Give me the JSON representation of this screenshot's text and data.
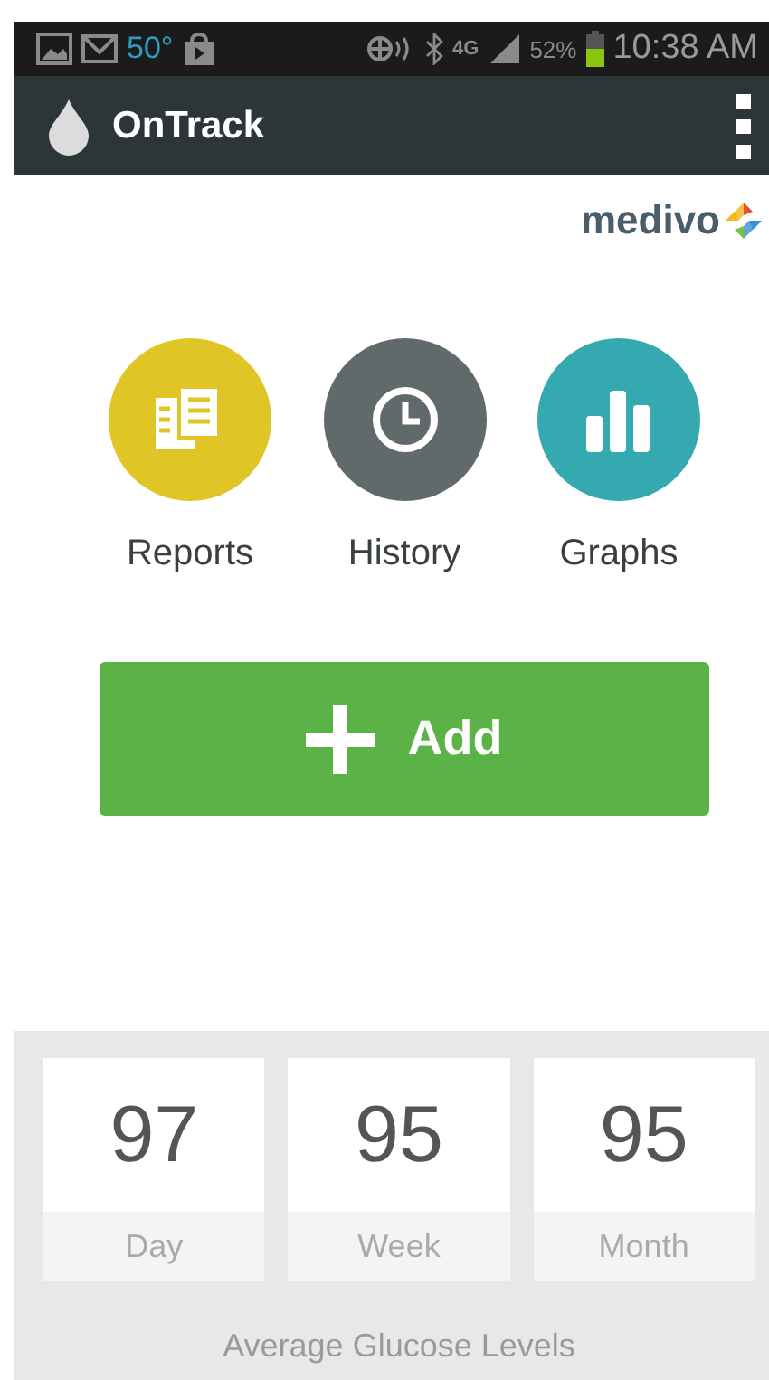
{
  "status_bar": {
    "temperature": "50°",
    "network": "4G",
    "battery": "52%",
    "time": "10:38 AM"
  },
  "app_bar": {
    "title": "OnTrack"
  },
  "brand": {
    "name": "medivo"
  },
  "shortcuts": [
    {
      "kind": "reports",
      "label": "Reports",
      "color": "#e0c527"
    },
    {
      "kind": "history",
      "label": "History",
      "color": "#616a6a"
    },
    {
      "kind": "graphs",
      "label": "Graphs",
      "color": "#34a9b0"
    }
  ],
  "add_button": {
    "label": "Add"
  },
  "averages": {
    "caption": "Average Glucose Levels",
    "items": [
      {
        "value": "97",
        "period": "Day"
      },
      {
        "value": "95",
        "period": "Week"
      },
      {
        "value": "95",
        "period": "Month"
      }
    ]
  }
}
